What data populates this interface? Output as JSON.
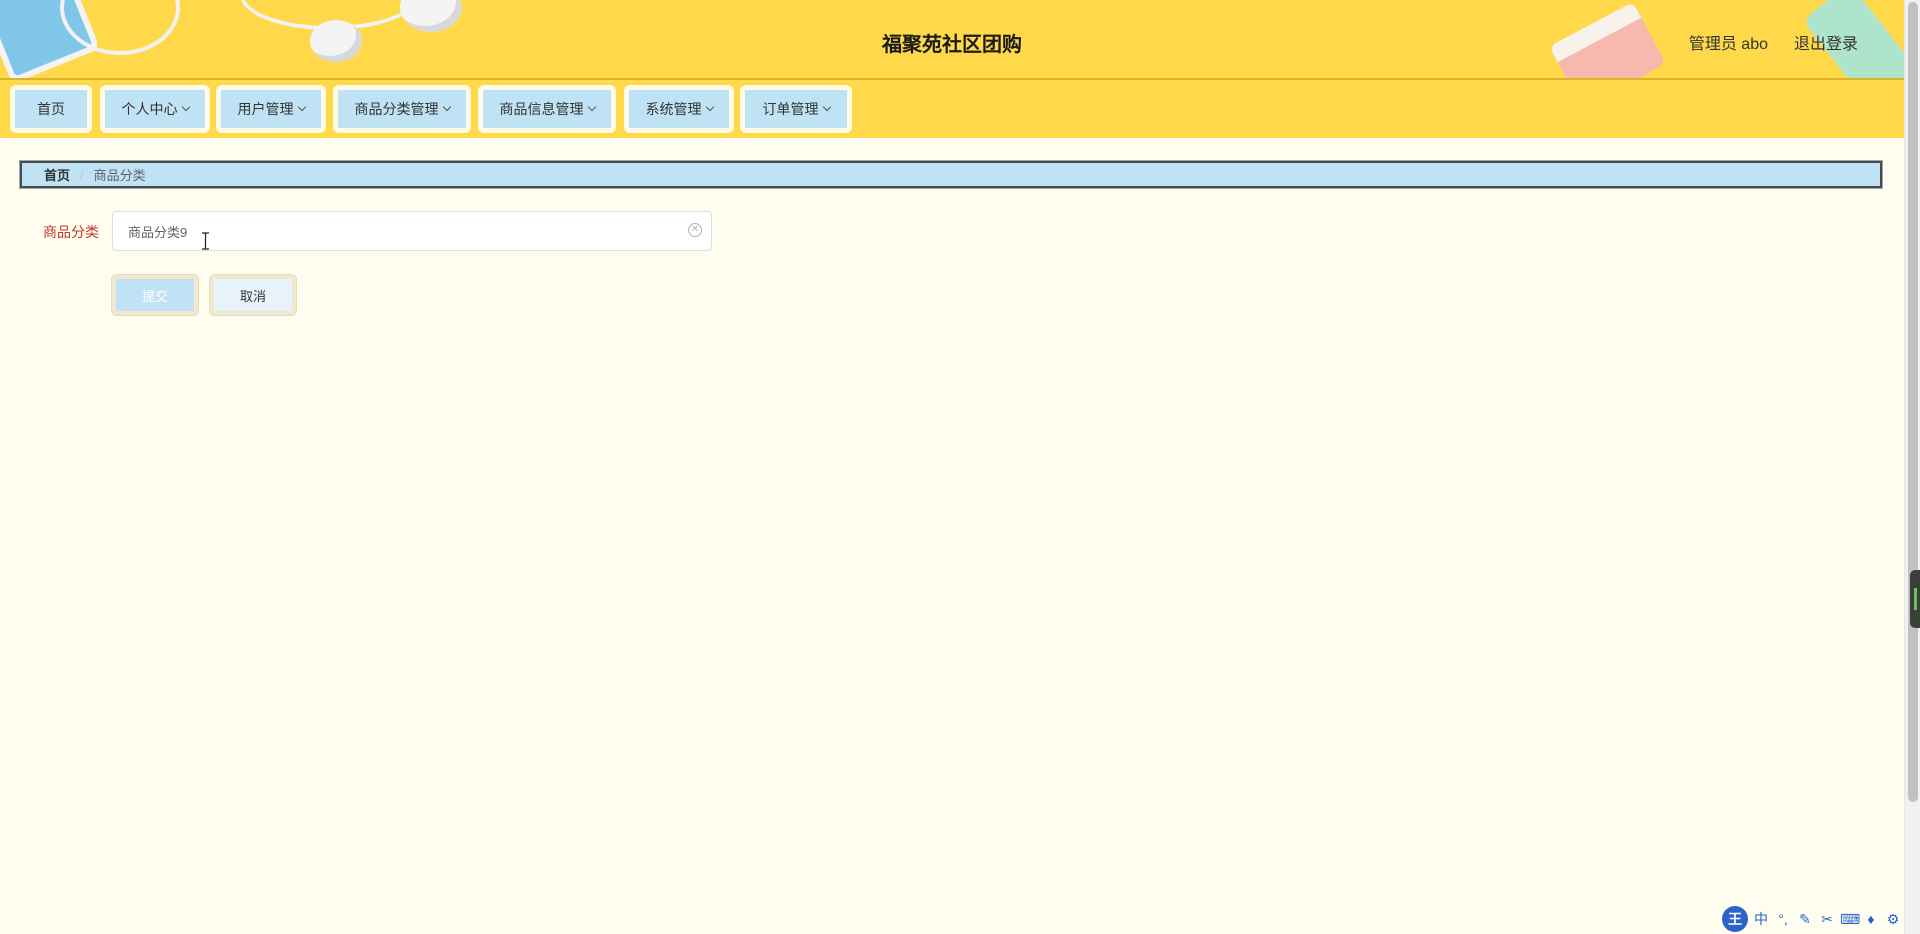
{
  "header": {
    "title": "福聚苑社区团购",
    "user_label": "管理员 abo",
    "logout_label": "退出登录"
  },
  "nav": {
    "items": [
      {
        "label": "首页",
        "has_dropdown": false
      },
      {
        "label": "个人中心",
        "has_dropdown": true
      },
      {
        "label": "用户管理",
        "has_dropdown": true
      },
      {
        "label": "商品分类管理",
        "has_dropdown": true
      },
      {
        "label": "商品信息管理",
        "has_dropdown": true
      },
      {
        "label": "系统管理",
        "has_dropdown": true
      },
      {
        "label": "订单管理",
        "has_dropdown": true
      }
    ]
  },
  "breadcrumb": {
    "home": "首页",
    "separator": "/",
    "current": "商品分类"
  },
  "form": {
    "field_label": "商品分类",
    "field_value": "商品分类9",
    "submit_label": "提交",
    "cancel_label": "取消"
  },
  "ime": {
    "logo": "王",
    "mode": "中",
    "icons": [
      "punctuation-icon",
      "pen-icon",
      "scissors-icon",
      "keyboard-icon",
      "shirt-icon",
      "gear-icon"
    ]
  },
  "colors": {
    "header_bg": "#ffd94a",
    "nav_button_bg": "#bfe3f5",
    "page_bg": "#fffdf0",
    "label_required": "#c0392b"
  }
}
